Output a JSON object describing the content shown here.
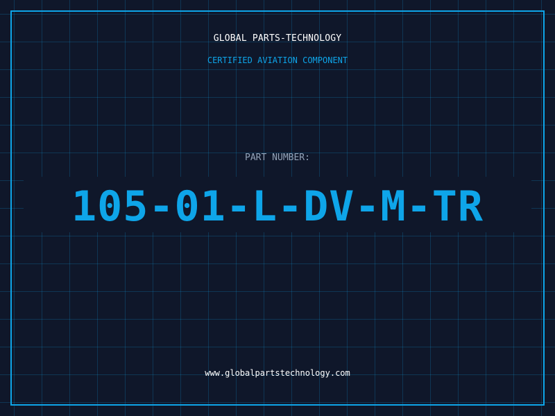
{
  "header": {
    "company": "GLOBAL PARTS-TECHNOLOGY",
    "subtitle": "CERTIFIED AVIATION COMPONENT"
  },
  "part": {
    "label": "PART NUMBER:",
    "number": "105-01-L-DV-M-TR"
  },
  "footer": {
    "website": "www.globalpartstechnology.com"
  },
  "colors": {
    "background": "#0f172a",
    "accent": "#0ea5e9",
    "grid": "#0ea5e9",
    "label": "#94a3b8",
    "text": "#ffffff"
  }
}
